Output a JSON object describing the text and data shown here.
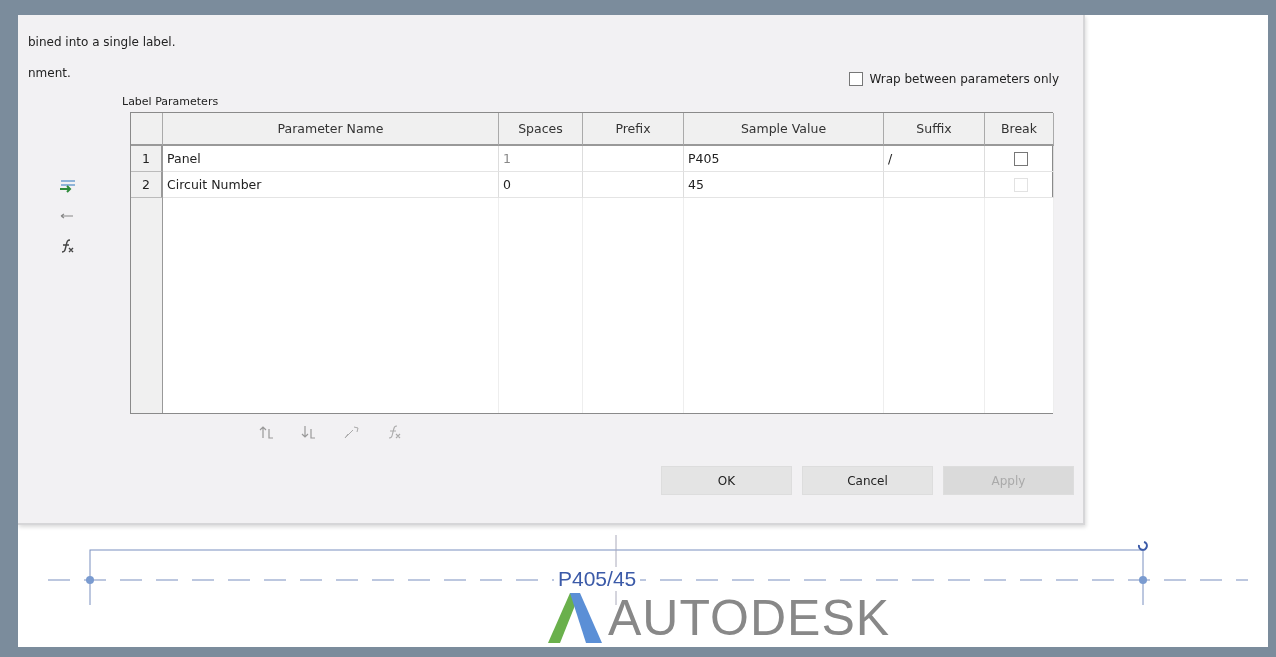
{
  "dialog": {
    "intro_lines": [
      "bined into a single label.",
      "nment."
    ],
    "wrap_option": {
      "label": "Wrap between parameters only",
      "checked": false
    },
    "group_title": "Label Parameters",
    "columns": [
      "Parameter Name",
      "Spaces",
      "Prefix",
      "Sample Value",
      "Suffix",
      "Break"
    ],
    "rows": [
      {
        "number": "1",
        "parameter_name": "Panel",
        "spaces": "1",
        "prefix_value": "",
        "sample_value": "P405",
        "suffix_value": "/",
        "break": {
          "checked": false,
          "disabled": false
        }
      },
      {
        "number": "2",
        "parameter_name": "Circuit Number",
        "spaces": "0",
        "prefix_value": "",
        "sample_value": "45",
        "suffix_value": "",
        "break": {
          "checked": false,
          "disabled": true
        }
      }
    ],
    "buttons": [
      {
        "label": "OK",
        "disabled": false
      },
      {
        "label": "Cancel",
        "disabled": false
      },
      {
        "label": "Apply",
        "disabled": true
      }
    ]
  },
  "canvas": {
    "tag_text": "P405/45"
  },
  "logo": {
    "text": "AUTODESK"
  }
}
